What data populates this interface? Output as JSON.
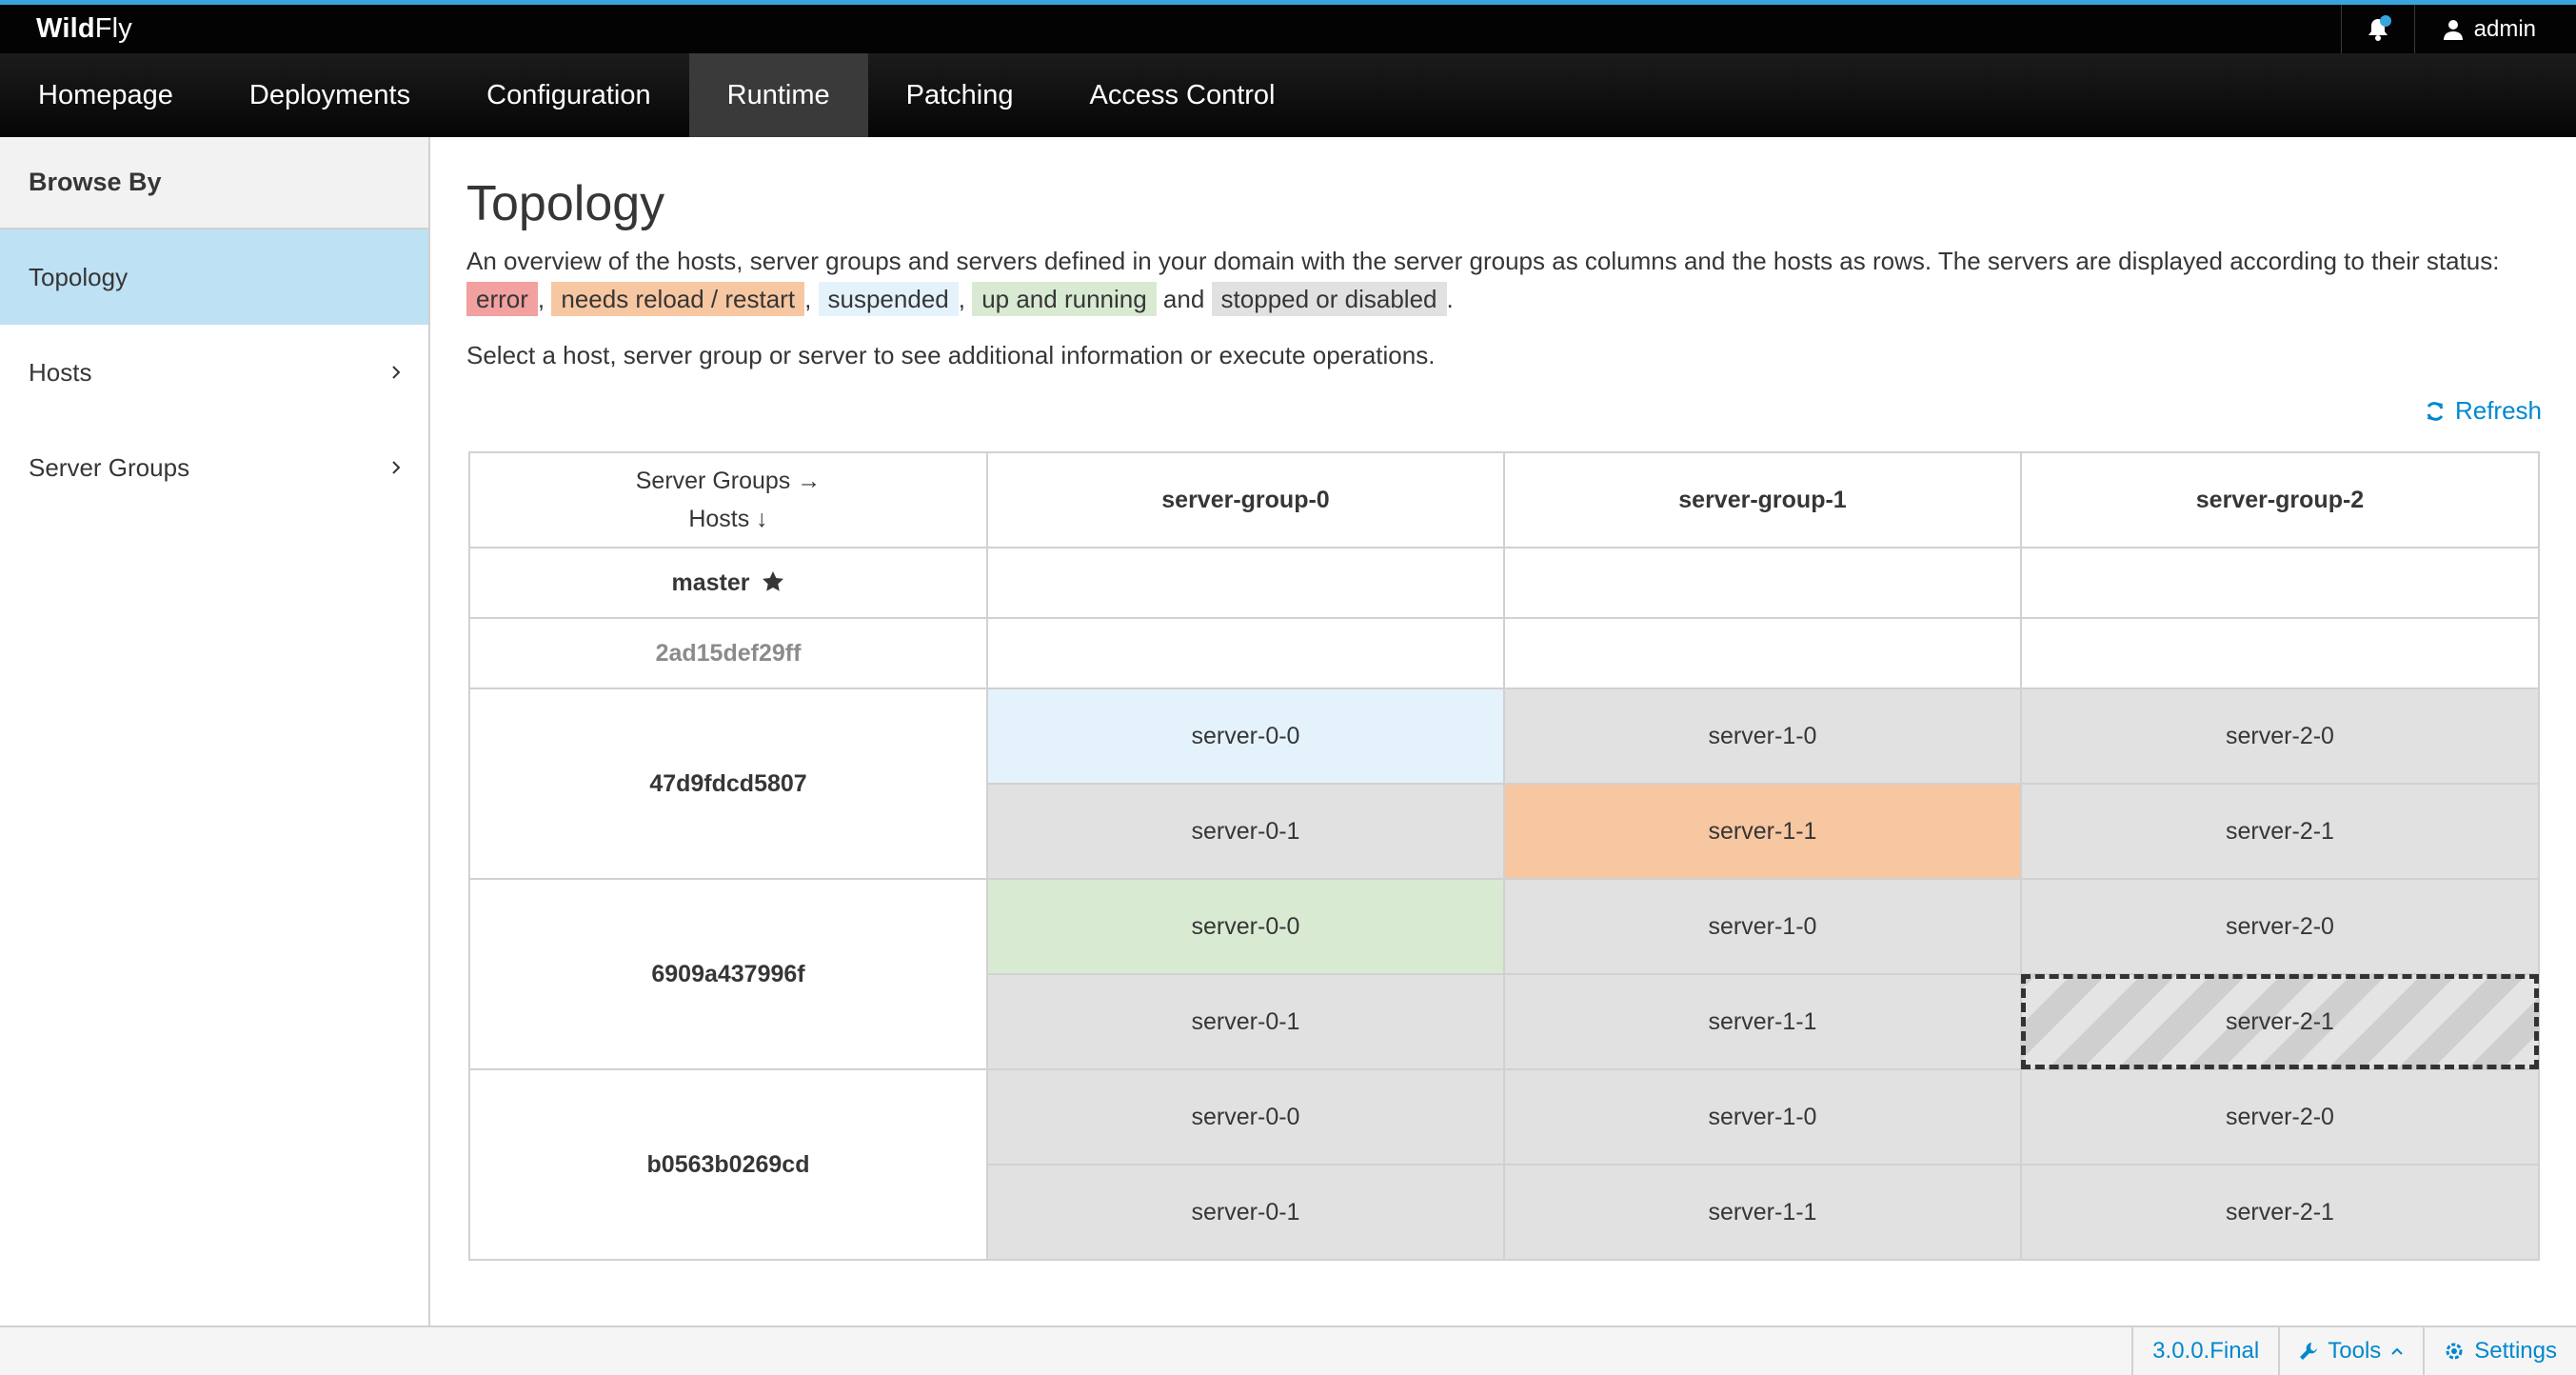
{
  "header": {
    "brand_bold": "Wild",
    "brand_rest": "Fly",
    "user": "admin"
  },
  "nav": {
    "items": [
      "Homepage",
      "Deployments",
      "Configuration",
      "Runtime",
      "Patching",
      "Access Control"
    ],
    "active": "Runtime"
  },
  "sidebar": {
    "heading": "Browse By",
    "items": [
      {
        "label": "Topology",
        "active": true
      },
      {
        "label": "Hosts",
        "active": false
      },
      {
        "label": "Server Groups",
        "active": false
      }
    ]
  },
  "page": {
    "title": "Topology",
    "desc_intro": "An overview of the hosts, server groups and servers defined in your domain with the server groups as columns and the hosts as rows. The servers are displayed according to their status:",
    "status_error": "error",
    "status_reload": "needs reload / restart",
    "status_suspended": "suspended",
    "status_running": "up and running",
    "and_word": "and",
    "status_stopped": "stopped or disabled",
    "select_hint": "Select a host, server group or server to see additional information or execute operations.",
    "refresh_label": "Refresh"
  },
  "topology": {
    "corner_groups": "Server Groups →",
    "corner_hosts": "Hosts ↓",
    "groups": [
      "server-group-0",
      "server-group-1",
      "server-group-2"
    ],
    "hosts": [
      {
        "name": "master",
        "star": true,
        "muted": false,
        "servers": []
      },
      {
        "name": "2ad15def29ff",
        "star": false,
        "muted": true,
        "servers": []
      },
      {
        "name": "47d9fdcd5807",
        "star": false,
        "muted": false,
        "servers": [
          [
            {
              "name": "server-0-0",
              "status": "suspended"
            },
            {
              "name": "server-1-0",
              "status": "stopped"
            },
            {
              "name": "server-2-0",
              "status": "stopped"
            }
          ],
          [
            {
              "name": "server-0-1",
              "status": "stopped"
            },
            {
              "name": "server-1-1",
              "status": "reload"
            },
            {
              "name": "server-2-1",
              "status": "stopped"
            }
          ]
        ]
      },
      {
        "name": "6909a437996f",
        "star": false,
        "muted": false,
        "servers": [
          [
            {
              "name": "server-0-0",
              "status": "running"
            },
            {
              "name": "server-1-0",
              "status": "stopped"
            },
            {
              "name": "server-2-0",
              "status": "stopped"
            }
          ],
          [
            {
              "name": "server-0-1",
              "status": "stopped"
            },
            {
              "name": "server-1-1",
              "status": "stopped"
            },
            {
              "name": "server-2-1",
              "status": "stopped",
              "selected": true
            }
          ]
        ]
      },
      {
        "name": "b0563b0269cd",
        "star": false,
        "muted": false,
        "servers": [
          [
            {
              "name": "server-0-0",
              "status": "stopped"
            },
            {
              "name": "server-1-0",
              "status": "stopped"
            },
            {
              "name": "server-2-0",
              "status": "stopped"
            }
          ],
          [
            {
              "name": "server-0-1",
              "status": "stopped"
            },
            {
              "name": "server-1-1",
              "status": "stopped"
            },
            {
              "name": "server-2-1",
              "status": "stopped"
            }
          ]
        ]
      }
    ]
  },
  "footer": {
    "version": "3.0.0.Final",
    "tools": "Tools",
    "settings": "Settings"
  },
  "colors": {
    "accent": "#39a5dc",
    "link": "#0088ce",
    "error": "#f2a0a0",
    "reload": "#f7c7a2",
    "suspended": "#e4f2fb",
    "running": "#d9ead3",
    "stopped": "#e1e1e1"
  }
}
